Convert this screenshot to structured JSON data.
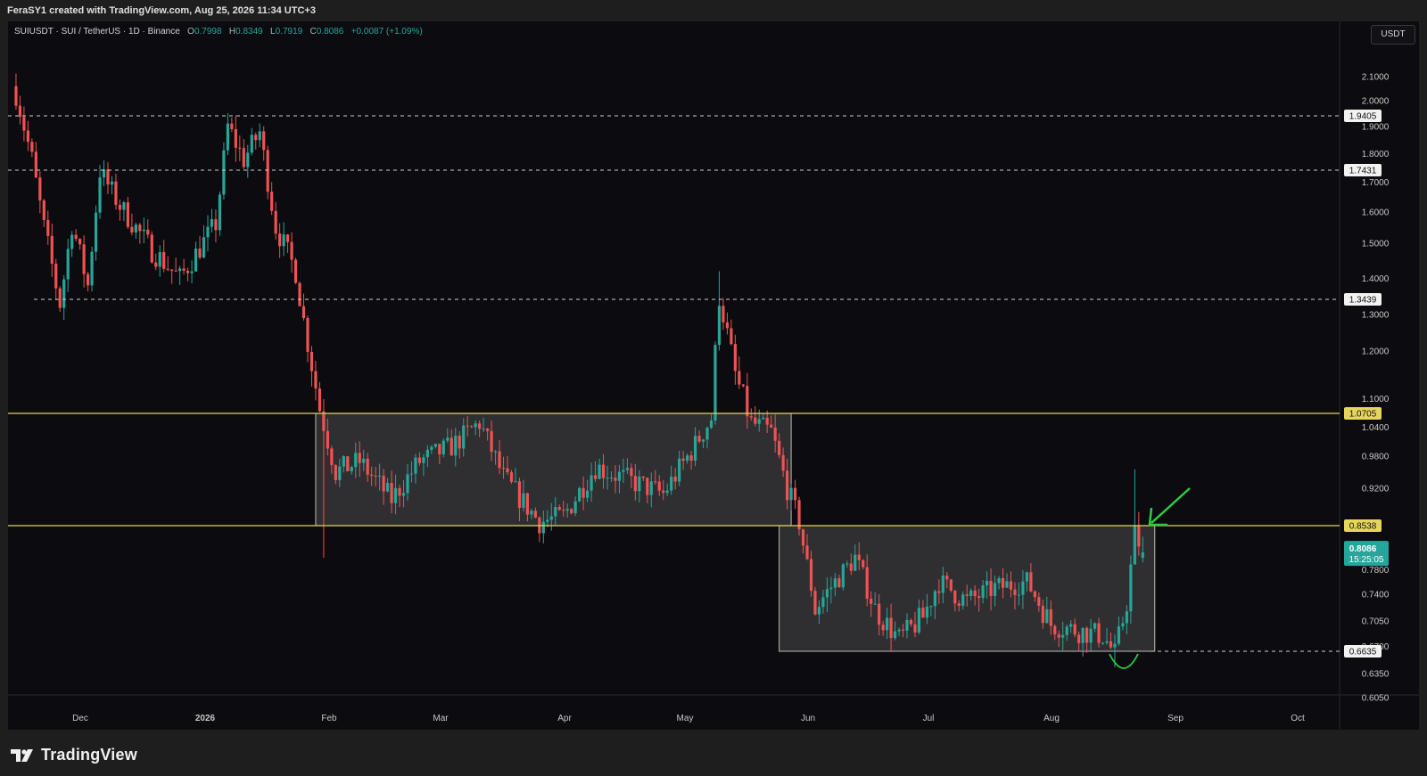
{
  "credit": "FeraSY1 created with TradingView.com, Aug 25, 2026 11:34 UTC+3",
  "symbol": {
    "title": "SUIUSDT · SUI / TetherUS · 1D · Binance",
    "o_label": "O",
    "o": "0.7998",
    "h_label": "H",
    "h": "0.8349",
    "l_label": "L",
    "l": "0.7919",
    "c_label": "C",
    "c": "0.8086",
    "change": "+0.0087 (+1.09%)"
  },
  "currency": "USDT",
  "brand": "TradingView",
  "colors": {
    "background": "#0b0b10",
    "up": "#26a69a",
    "down": "#ef5350",
    "level_line": "#e6d65c",
    "box_fill": "rgba(90,90,90,0.45)",
    "annotation": "#2ecc40"
  },
  "chart_data": {
    "type": "candlestick",
    "symbol": "SUIUSDT",
    "timeframe": "1D",
    "x_ticks": [
      "Dec",
      "2026",
      "Feb",
      "Mar",
      "Apr",
      "May",
      "Jun",
      "Jul",
      "Aug",
      "Sep",
      "Oct"
    ],
    "y_ticks": [
      "2.1000",
      "2.0000",
      "1.9000",
      "1.8000",
      "1.7000",
      "1.6000",
      "1.5000",
      "1.4000",
      "1.3000",
      "1.2000",
      "1.1000",
      "1.0400",
      "0.9800",
      "0.9200",
      "0.8200",
      "0.7800",
      "0.7400",
      "0.7050",
      "0.6700",
      "0.6350",
      "0.6050"
    ],
    "y_scale": "log",
    "ylim": [
      0.59,
      2.25
    ],
    "price_labels": [
      {
        "value": "1.9405",
        "style": "dashed",
        "color": "white"
      },
      {
        "value": "1.7431",
        "style": "dashed",
        "color": "white"
      },
      {
        "value": "1.3439",
        "style": "dashed",
        "color": "white"
      },
      {
        "value": "1.0705",
        "style": "solid",
        "color": "yellow"
      },
      {
        "value": "0.8538",
        "style": "solid",
        "color": "yellow"
      },
      {
        "value": "0.6635",
        "style": "dashed",
        "color": "white"
      }
    ],
    "current_price": {
      "value": "0.8086",
      "countdown": "15:25:05"
    },
    "ranges": [
      {
        "from": "2026-01-30",
        "to": "2026-05-28",
        "low": 0.8538,
        "high": 1.0705
      },
      {
        "from": "2026-05-28",
        "to": "2026-08-25",
        "low": 0.6635,
        "high": 0.8538
      }
    ],
    "anchors": [
      [
        "2025-11-16",
        2.03
      ],
      [
        "2025-11-20",
        1.78
      ],
      [
        "2025-11-23",
        1.55
      ],
      [
        "2025-11-27",
        1.33
      ],
      [
        "2025-11-30",
        1.56
      ],
      [
        "2025-12-04",
        1.38
      ],
      [
        "2025-12-07",
        1.74
      ],
      [
        "2025-12-12",
        1.62
      ],
      [
        "2025-12-20",
        1.48
      ],
      [
        "2025-12-27",
        1.4
      ],
      [
        "2026-01-05",
        1.56
      ],
      [
        "2026-01-08",
        1.9
      ],
      [
        "2026-01-12",
        1.78
      ],
      [
        "2026-01-16",
        1.88
      ],
      [
        "2026-01-20",
        1.55
      ],
      [
        "2026-01-25",
        1.42
      ],
      [
        "2026-01-28",
        1.22
      ],
      [
        "2026-01-31",
        1.08
      ],
      [
        "2026-02-04",
        0.95
      ],
      [
        "2026-02-10",
        0.97
      ],
      [
        "2026-02-18",
        0.9
      ],
      [
        "2026-02-25",
        0.97
      ],
      [
        "2026-03-05",
        1.0
      ],
      [
        "2026-03-12",
        1.05
      ],
      [
        "2026-03-18",
        0.94
      ],
      [
        "2026-03-27",
        0.86
      ],
      [
        "2026-04-02",
        0.87
      ],
      [
        "2026-04-10",
        0.96
      ],
      [
        "2026-04-20",
        0.93
      ],
      [
        "2026-04-27",
        0.91
      ],
      [
        "2026-05-04",
        0.99
      ],
      [
        "2026-05-09",
        1.06
      ],
      [
        "2026-05-11",
        1.35
      ],
      [
        "2026-05-15",
        1.15
      ],
      [
        "2026-05-19",
        1.05
      ],
      [
        "2026-05-24",
        1.03
      ],
      [
        "2026-05-28",
        0.92
      ],
      [
        "2026-05-31",
        0.86
      ],
      [
        "2026-06-04",
        0.72
      ],
      [
        "2026-06-09",
        0.76
      ],
      [
        "2026-06-14",
        0.8
      ],
      [
        "2026-06-19",
        0.72
      ],
      [
        "2026-06-25",
        0.68
      ],
      [
        "2026-07-01",
        0.71
      ],
      [
        "2026-07-05",
        0.76
      ],
      [
        "2026-07-12",
        0.73
      ],
      [
        "2026-07-19",
        0.75
      ],
      [
        "2026-07-27",
        0.76
      ],
      [
        "2026-08-02",
        0.7
      ],
      [
        "2026-08-10",
        0.69
      ],
      [
        "2026-08-15",
        0.685
      ],
      [
        "2026-08-18",
        0.66
      ],
      [
        "2026-08-21",
        0.73
      ],
      [
        "2026-08-23",
        0.84
      ],
      [
        "2026-08-25",
        0.81
      ]
    ],
    "spikes": [
      {
        "date": "2026-05-11",
        "high": 1.42
      },
      {
        "date": "2026-08-23",
        "high": 0.955
      },
      {
        "date": "2026-08-18",
        "low": 0.643
      },
      {
        "date": "2026-02-01",
        "low": 0.8
      }
    ]
  }
}
